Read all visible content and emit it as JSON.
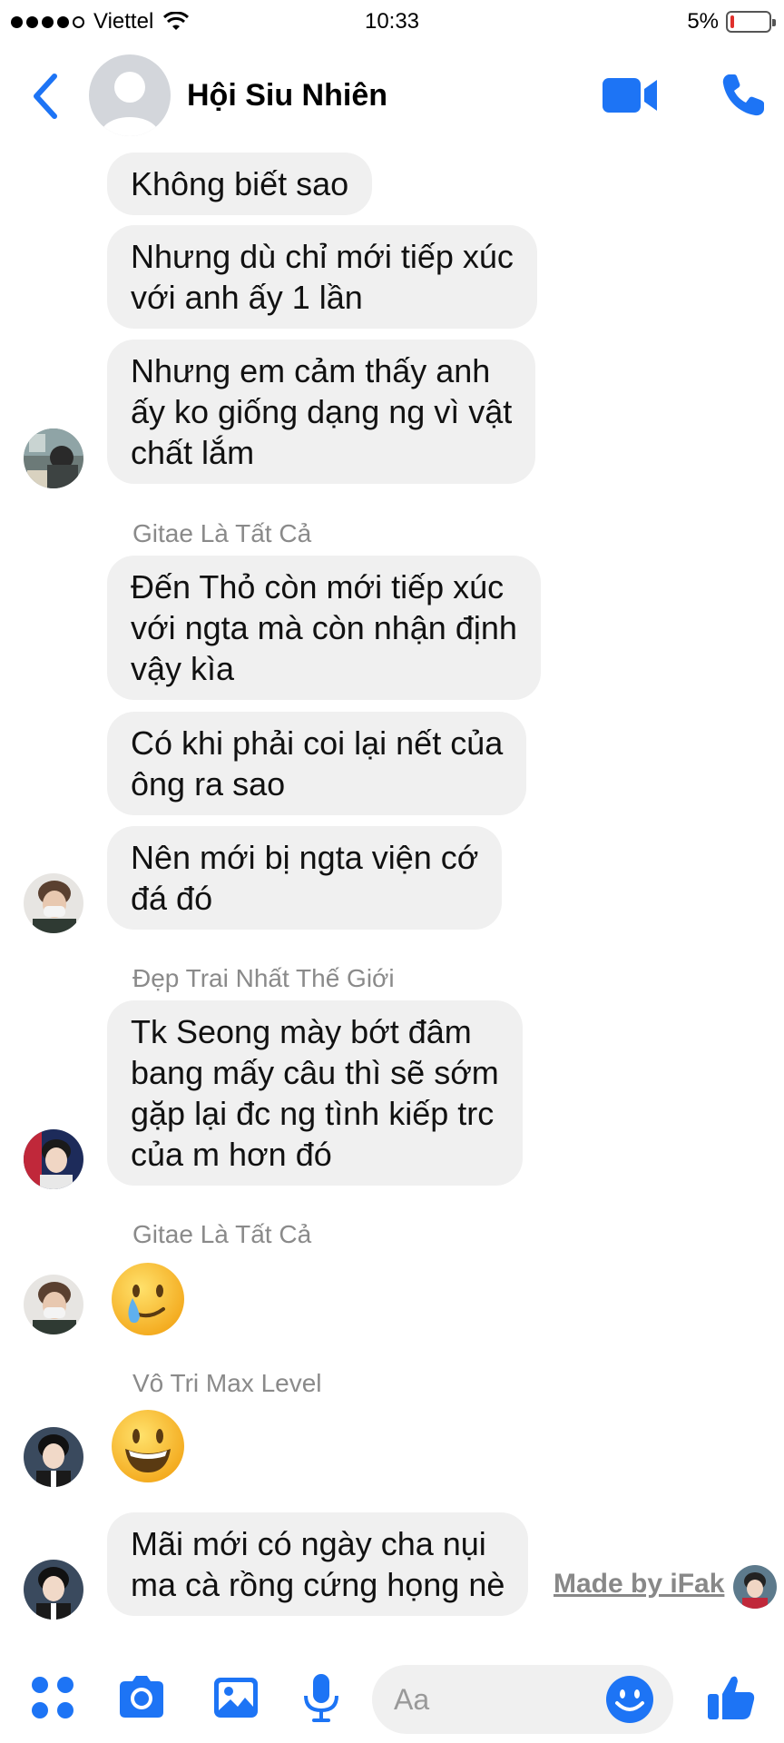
{
  "status_bar": {
    "carrier": "Viettel",
    "time": "10:33",
    "battery": "5%",
    "battery_level": 0.05
  },
  "header": {
    "title": "Hội Siu Nhiên"
  },
  "messages": {
    "m1": "Không biết sao",
    "m2": "Nhưng dù chỉ mới tiếp xúc\nvới anh ấy 1 lần",
    "m3": "Nhưng em cảm thấy anh\nấy ko giống dạng ng vì vật\nchất lắm",
    "sender2": "Gitae Là Tất Cả",
    "m4": "Đến Thỏ còn mới tiếp xúc\nvới ngta mà còn nhận định\nvậy kìa",
    "m5": "Có khi phải coi lại nết của\nông ra sao",
    "m6": "Nên mới bị ngta viện cớ\nđá đó",
    "sender3": "Đẹp Trai Nhất Thế Giới",
    "m7": "Tk Seong mày bớt đâm\nbang mấy câu thì sẽ sớm\ngặp lại đc ng tình kiếp trc\ncủa m hơn đó",
    "sender4": "Gitae Là Tất Cả",
    "sender5": "Vô Tri Max Level",
    "m8": "Mãi mới có ngày cha nụi\nma cà rồng cứng họng nè"
  },
  "watermark": "Made by iFak",
  "composer": {
    "placeholder": "Aa"
  },
  "colors": {
    "accent": "#1d74f5",
    "bubble": "#f0f0f0",
    "sender": "#8a8a8a"
  }
}
